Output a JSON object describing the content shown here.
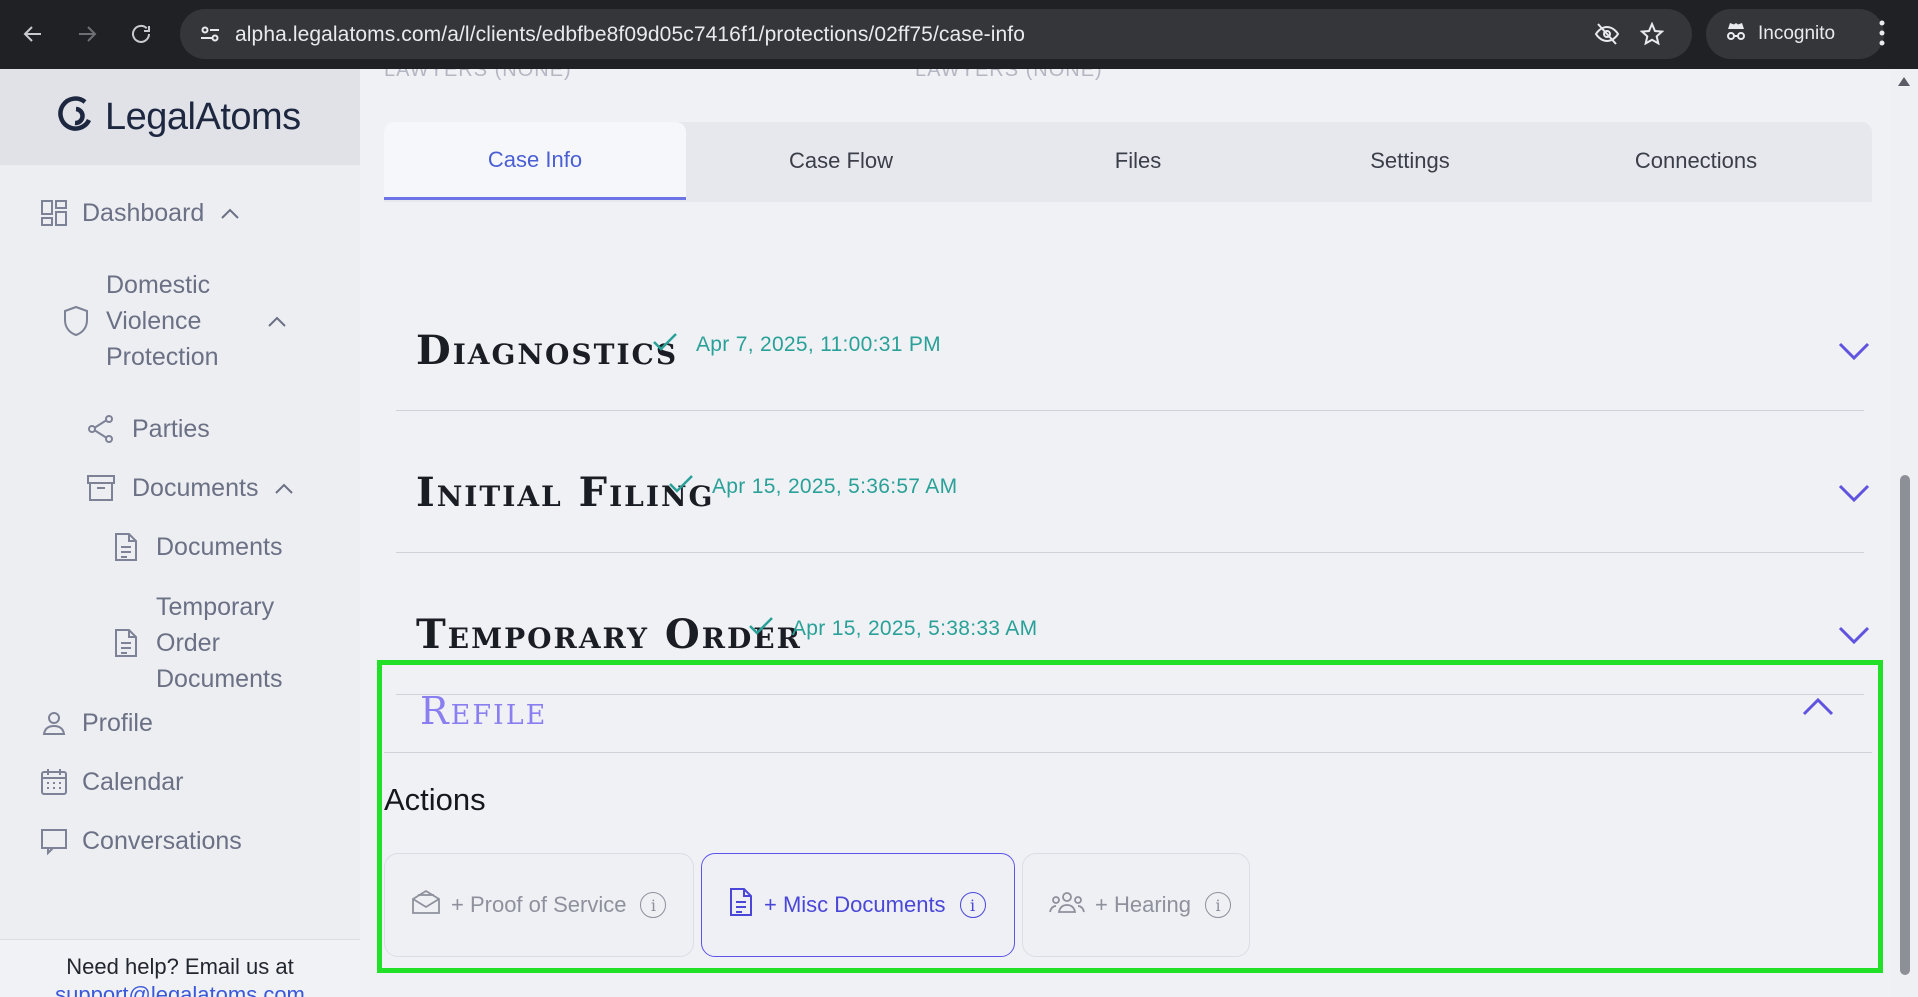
{
  "browser": {
    "url": "alpha.legalatoms.com/a/l/clients/edbfbe8f09d05c7416f1/protections/02ff75/case-info",
    "profile_label": "Incognito"
  },
  "sidebar": {
    "logo": {
      "prefix": "Legal",
      "suffix": "Atoms"
    },
    "items": {
      "dashboard": "Dashboard",
      "dv_protection": [
        "Domestic",
        "Violence",
        "Protection"
      ],
      "parties": "Parties",
      "documents_group": "Documents",
      "documents": "Documents",
      "temporary_order_documents": [
        "Temporary",
        "Order",
        "Documents"
      ],
      "profile": "Profile",
      "calendar": "Calendar",
      "conversations": "Conversations"
    },
    "help": {
      "text": "Need help? Email us at",
      "email": "support@legalatoms.com"
    }
  },
  "main": {
    "cut_off": [
      "LAWYERS (NONE)",
      "LAWYERS (NONE)"
    ],
    "tabs": [
      "Case Info",
      "Case Flow",
      "Files",
      "Settings",
      "Connections"
    ],
    "active_tab": "Case Info",
    "sections": [
      {
        "title": "Diagnostics",
        "timestamp": "Apr 7, 2025, 11:00:31 PM"
      },
      {
        "title": "Initial Filing",
        "timestamp": "Apr 15, 2025, 5:36:57 AM"
      },
      {
        "title": "Temporary Order",
        "timestamp": "Apr 15, 2025, 5:38:33 AM"
      }
    ],
    "refile": {
      "title": "Refile",
      "actions_heading": "Actions",
      "actions": [
        "+ Proof of Service",
        "+ Misc Documents",
        "+ Hearing"
      ]
    }
  },
  "colors": {
    "accent": "#5f53e0",
    "status_teal": "#2aa198",
    "highlight": "#22e028"
  }
}
